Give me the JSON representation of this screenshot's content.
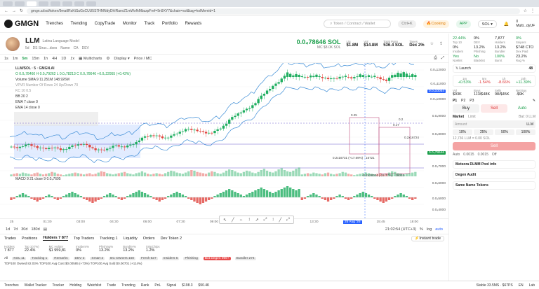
{
  "browser": {
    "url": "gmgn.ai/sol/token/9matIRsKtSuGsCUU5S7HMNdyDhIRaevZ1mWxfhMbzzpFref=9n9XY7&chain=sol&tag=kolMemid=1"
  },
  "appbar": {
    "logo": "GMGN",
    "nav": [
      "Trenches",
      "Trending",
      "CopyTrade",
      "Monitor",
      "Track",
      "Portfolio",
      "Rewards"
    ],
    "search_placeholder": "Token / Contract / Wallet",
    "search_hint": "Ctrl+K",
    "cooking": "Cooking",
    "app": "APP",
    "chain": "SOL",
    "balance": "0",
    "wallet": "Multi...dyUF"
  },
  "token": {
    "symbol": "LLM",
    "name": "Latina Language Model",
    "meta": [
      "5d",
      "DS Struc...dses",
      "Name",
      "CA",
      "DEV"
    ],
    "price": "0.0₄78646 SOL",
    "price_usd": "MC $8.0K SOL",
    "stats": [
      {
        "k": "Liq",
        "v": "$1.8M"
      },
      {
        "k": "Vol",
        "v": "$14.8M"
      },
      {
        "k": "Total Pairs",
        "v": "536.4 SOL"
      },
      {
        "k": "Taxes",
        "v": "Dex 2%"
      }
    ]
  },
  "toolbar": {
    "timeframes": [
      "1s",
      "1m",
      "5m",
      "15m",
      "1h",
      "4H",
      "1D"
    ],
    "items": [
      "Multicharts",
      "Display",
      "Price / MC"
    ]
  },
  "chart_data": {
    "type": "candlestick",
    "title": "LLM/SOL · 5 · GMGN.AI",
    "ohlc": "O 0.0₄78460 H 0.0₄79262 L 0.0₄78213 C 0.0₄78646 +0.0₄22955 (+0.42%)",
    "indicators": [
      "Volume SMA 9  11.251M  148.926M",
      "VPVR Number Of Rows 24 Up/Down 70",
      "KC 10 0.5",
      "BB 20 2",
      "EMA 7 close 0",
      "EMA 14 close 0"
    ],
    "y_ticks": [
      "0.0₄12000",
      "0.0₄11000",
      "0.0₄10000",
      "0.0₄9000",
      "0.0₄8000",
      "0.0₄7000",
      "0.0₄6000",
      "0.0₄5000",
      "0.0₄4000",
      "0.0₄3000"
    ],
    "price_tag": "0.0₄78646",
    "price_tag_2": "0.0₄10054",
    "x_ticks": [
      "25",
      "01:30",
      "03:00",
      "04:30",
      "06:00",
      "07:30",
      "09:00",
      "10:30",
      "12:00",
      "13:30",
      "25 Aug '25",
      "15:45",
      "18:00"
    ],
    "annotations": [
      "0.25",
      "0.17",
      "0.2",
      "0.2x16731 (+17.69%) · 16721",
      "-0.2x28034 (-22.77%) · 28033",
      "0.2x16724"
    ],
    "macd_label": "MACD 9 21 close 9  0.0₄7695",
    "volume_series": [
      3,
      4,
      5,
      4,
      6,
      5,
      4,
      3,
      5,
      6,
      4,
      3,
      4,
      5,
      7,
      6,
      4,
      3,
      2,
      3,
      4,
      5,
      6,
      5,
      4,
      3,
      4,
      5,
      3,
      4,
      6,
      8,
      7,
      5,
      4,
      3,
      4,
      5,
      6,
      7,
      5,
      4,
      3,
      5,
      6,
      8,
      6,
      4,
      3,
      4,
      5,
      4,
      3,
      5,
      7,
      9,
      8,
      6,
      5,
      4,
      6,
      8,
      10,
      9,
      7,
      6,
      5,
      4,
      6,
      8,
      7,
      5,
      4,
      6,
      9,
      11,
      10,
      8,
      6,
      5,
      7,
      9,
      8,
      6,
      5,
      7,
      10,
      12,
      9,
      7,
      6,
      8,
      11,
      13,
      10,
      8,
      7,
      9,
      12,
      14
    ],
    "macd_series": [
      -2,
      -1,
      1,
      2,
      3,
      2,
      1,
      -1,
      -2,
      -3,
      -2,
      -1,
      1,
      2,
      1,
      -1,
      -2,
      -1,
      1,
      2,
      3,
      4,
      3,
      2,
      1,
      -1,
      -2,
      -3,
      -4,
      -3,
      -2,
      -1,
      1,
      2,
      3,
      2,
      1,
      -1,
      -2,
      -1,
      1,
      2,
      3,
      4,
      5,
      4,
      3,
      2,
      1,
      -1,
      -2,
      -3,
      -2,
      -1,
      1,
      2,
      3,
      4,
      3,
      2,
      1,
      -1,
      -2,
      -3,
      -4,
      -5,
      -4,
      -3,
      -2,
      -1,
      1,
      2,
      3,
      4,
      5,
      6,
      5,
      4,
      3,
      2,
      1,
      2,
      3,
      4,
      5,
      6,
      7,
      6,
      5,
      4,
      3,
      4,
      5,
      6,
      7,
      8,
      7,
      6,
      5,
      6
    ]
  },
  "rangebar": {
    "ranges": [
      "1d",
      "7d",
      "30d",
      "180d"
    ],
    "clock": "21:02:54 (UTC+3)",
    "scale": [
      "%",
      "log",
      "auto"
    ]
  },
  "drawtools": [
    "↖",
    "╱",
    "↔",
    "↕",
    "↗",
    "⤢",
    "↕",
    "╱",
    "⤢"
  ],
  "bottomtabs": {
    "tabs": [
      "Trades",
      "Positions",
      "Holders 7 877",
      "Top Traders",
      "Tracking 1",
      "Liquidity",
      "Orders",
      "Dev Token 2"
    ],
    "instant": "Instant trade"
  },
  "holderstats": [
    {
      "k": "Holders",
      "v": "7 877"
    },
    {
      "k": "Top 10 (%)",
      "v": "22.4%"
    },
    {
      "k": "MC Holder",
      "v": "$1 959,81"
    },
    {
      "k": "Insiders%",
      "v": "0%"
    },
    {
      "k": "Phishing%",
      "v": "13.2%"
    },
    {
      "k": "Bundler%",
      "v": "13.2%"
    },
    {
      "k": "SnipChips",
      "v": "1.2%"
    }
  ],
  "subtabs": [
    {
      "label": "All",
      "red": false
    },
    {
      "label": "KOL 11",
      "red": false
    },
    {
      "label": "Tracking 1",
      "red": false
    },
    {
      "label": "Remarks",
      "red": false
    },
    {
      "label": "DEV 2",
      "red": false
    },
    {
      "label": "Smart 2",
      "red": false
    },
    {
      "label": "BC Owners 150",
      "red": false
    },
    {
      "label": "Fresh 627",
      "red": false
    },
    {
      "label": "Insiders 5",
      "red": false
    },
    {
      "label": "Phishing",
      "red": false
    },
    {
      "label": "Bot Degen 999+",
      "red": true
    },
    {
      "label": "Bundler 274",
      "red": false
    }
  ],
  "topline": "TOP100 Owned 82.03%   TOP100 Avg Cost $0.00585 (+73%)   TOP100 Avg Sold $0.00701 (+114%)",
  "right": {
    "top_stats": [
      {
        "k": "Top 10",
        "v": "22.44%",
        "c": "green"
      },
      {
        "k": "DEV",
        "v": "0%",
        "c": ""
      },
      {
        "k": "Holders",
        "v": "7,877",
        "c": ""
      },
      {
        "k": "Snipers",
        "v": "0%",
        "c": "green"
      },
      {
        "k": "Insiders",
        "v": "0%",
        "c": ""
      },
      {
        "k": "Phishing",
        "v": "13.2%",
        "c": ""
      },
      {
        "k": "Bundler",
        "v": "13.2%",
        "c": ""
      },
      {
        "k": "Dex Paid",
        "v": "$748 CTO",
        "c": ""
      },
      {
        "k": "NoMint",
        "v": "Yes",
        "c": "green"
      },
      {
        "k": "Blacklist",
        "v": "No",
        "c": "green"
      },
      {
        "k": "Burnt",
        "v": "100%",
        "c": "green"
      },
      {
        "k": "Rug %",
        "v": "23.2%",
        "c": ""
      }
    ],
    "launch": "Launch",
    "launch_num": "48",
    "periods": [
      {
        "k": "1m",
        "v": "+0.53%",
        "c": "green"
      },
      {
        "k": "5m",
        "v": "-1.54%",
        "c": "red"
      },
      {
        "k": "1h",
        "v": "-8.66%",
        "c": "red"
      },
      {
        "k": "24h",
        "v": "+11.39%",
        "c": "green"
      }
    ],
    "flow": [
      {
        "k": "Vol",
        "v": "$93K"
      },
      {
        "k": "Buys",
        "v": "113/$48K"
      },
      {
        "k": "Sells",
        "v": "98/$45K"
      },
      {
        "k": "Net Buy",
        "v": "-$9K"
      }
    ],
    "presets": [
      "P1",
      "P2",
      "P3"
    ],
    "buy": "Buy",
    "sell": "Sell",
    "auto": "Auto",
    "market": "Market",
    "limit": "Limit",
    "bal": "Bal: 0 LLM",
    "amount": "Amount",
    "amount_unit": "LLM",
    "pcts": [
      "10%",
      "25%",
      "50%",
      "100%"
    ],
    "est": "12,736 LLM = 0.00 SOL",
    "sell_btn": "Sell",
    "flags": [
      "Auto",
      "0.0015",
      "0.0015",
      "Off"
    ],
    "sections": [
      "Meteora DLMM Pool info",
      "Degen Audit",
      "Same Name Tokens"
    ]
  },
  "bottombar": [
    "Trenches",
    "Wallet Tracker",
    "Tracker",
    "Holding",
    "Watchlist",
    "Trade",
    "Trending",
    "Rank",
    "PnL",
    "Signal",
    "$198.3",
    "$90.4K",
    "Stable 33.5MS · $67PS",
    "EN",
    "Lab"
  ]
}
